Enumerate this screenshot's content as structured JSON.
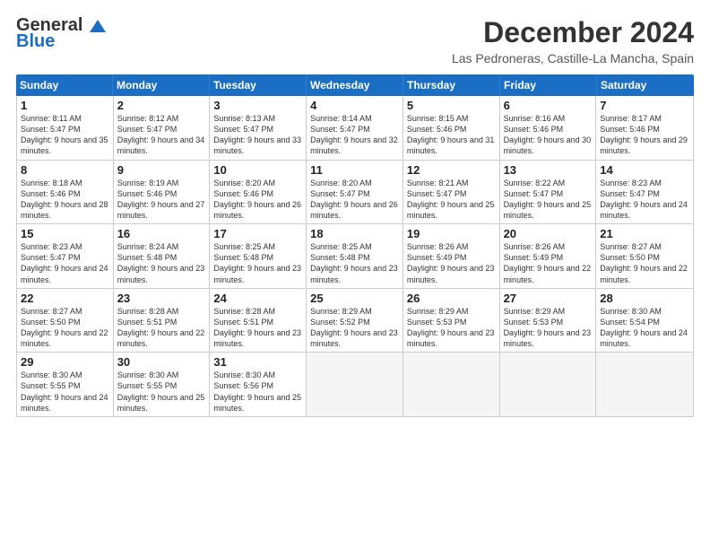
{
  "logo": {
    "general": "General",
    "blue": "Blue"
  },
  "header": {
    "month": "December 2024",
    "location": "Las Pedroneras, Castille-La Mancha, Spain"
  },
  "days": [
    "Sunday",
    "Monday",
    "Tuesday",
    "Wednesday",
    "Thursday",
    "Friday",
    "Saturday"
  ],
  "weeks": [
    [
      {
        "day": "1",
        "rise": "8:11 AM",
        "set": "5:47 PM",
        "daylight": "9 hours and 35 minutes."
      },
      {
        "day": "2",
        "rise": "8:12 AM",
        "set": "5:47 PM",
        "daylight": "9 hours and 34 minutes."
      },
      {
        "day": "3",
        "rise": "8:13 AM",
        "set": "5:47 PM",
        "daylight": "9 hours and 33 minutes."
      },
      {
        "day": "4",
        "rise": "8:14 AM",
        "set": "5:47 PM",
        "daylight": "9 hours and 32 minutes."
      },
      {
        "day": "5",
        "rise": "8:15 AM",
        "set": "5:46 PM",
        "daylight": "9 hours and 31 minutes."
      },
      {
        "day": "6",
        "rise": "8:16 AM",
        "set": "5:46 PM",
        "daylight": "9 hours and 30 minutes."
      },
      {
        "day": "7",
        "rise": "8:17 AM",
        "set": "5:46 PM",
        "daylight": "9 hours and 29 minutes."
      }
    ],
    [
      {
        "day": "8",
        "rise": "8:18 AM",
        "set": "5:46 PM",
        "daylight": "9 hours and 28 minutes."
      },
      {
        "day": "9",
        "rise": "8:19 AM",
        "set": "5:46 PM",
        "daylight": "9 hours and 27 minutes."
      },
      {
        "day": "10",
        "rise": "8:20 AM",
        "set": "5:46 PM",
        "daylight": "9 hours and 26 minutes."
      },
      {
        "day": "11",
        "rise": "8:20 AM",
        "set": "5:47 PM",
        "daylight": "9 hours and 26 minutes."
      },
      {
        "day": "12",
        "rise": "8:21 AM",
        "set": "5:47 PM",
        "daylight": "9 hours and 25 minutes."
      },
      {
        "day": "13",
        "rise": "8:22 AM",
        "set": "5:47 PM",
        "daylight": "9 hours and 25 minutes."
      },
      {
        "day": "14",
        "rise": "8:23 AM",
        "set": "5:47 PM",
        "daylight": "9 hours and 24 minutes."
      }
    ],
    [
      {
        "day": "15",
        "rise": "8:23 AM",
        "set": "5:47 PM",
        "daylight": "9 hours and 24 minutes."
      },
      {
        "day": "16",
        "rise": "8:24 AM",
        "set": "5:48 PM",
        "daylight": "9 hours and 23 minutes."
      },
      {
        "day": "17",
        "rise": "8:25 AM",
        "set": "5:48 PM",
        "daylight": "9 hours and 23 minutes."
      },
      {
        "day": "18",
        "rise": "8:25 AM",
        "set": "5:48 PM",
        "daylight": "9 hours and 23 minutes."
      },
      {
        "day": "19",
        "rise": "8:26 AM",
        "set": "5:49 PM",
        "daylight": "9 hours and 23 minutes."
      },
      {
        "day": "20",
        "rise": "8:26 AM",
        "set": "5:49 PM",
        "daylight": "9 hours and 22 minutes."
      },
      {
        "day": "21",
        "rise": "8:27 AM",
        "set": "5:50 PM",
        "daylight": "9 hours and 22 minutes."
      }
    ],
    [
      {
        "day": "22",
        "rise": "8:27 AM",
        "set": "5:50 PM",
        "daylight": "9 hours and 22 minutes."
      },
      {
        "day": "23",
        "rise": "8:28 AM",
        "set": "5:51 PM",
        "daylight": "9 hours and 22 minutes."
      },
      {
        "day": "24",
        "rise": "8:28 AM",
        "set": "5:51 PM",
        "daylight": "9 hours and 23 minutes."
      },
      {
        "day": "25",
        "rise": "8:29 AM",
        "set": "5:52 PM",
        "daylight": "9 hours and 23 minutes."
      },
      {
        "day": "26",
        "rise": "8:29 AM",
        "set": "5:53 PM",
        "daylight": "9 hours and 23 minutes."
      },
      {
        "day": "27",
        "rise": "8:29 AM",
        "set": "5:53 PM",
        "daylight": "9 hours and 23 minutes."
      },
      {
        "day": "28",
        "rise": "8:30 AM",
        "set": "5:54 PM",
        "daylight": "9 hours and 24 minutes."
      }
    ],
    [
      {
        "day": "29",
        "rise": "8:30 AM",
        "set": "5:55 PM",
        "daylight": "9 hours and 24 minutes."
      },
      {
        "day": "30",
        "rise": "8:30 AM",
        "set": "5:55 PM",
        "daylight": "9 hours and 25 minutes."
      },
      {
        "day": "31",
        "rise": "8:30 AM",
        "set": "5:56 PM",
        "daylight": "9 hours and 25 minutes."
      },
      null,
      null,
      null,
      null
    ]
  ]
}
